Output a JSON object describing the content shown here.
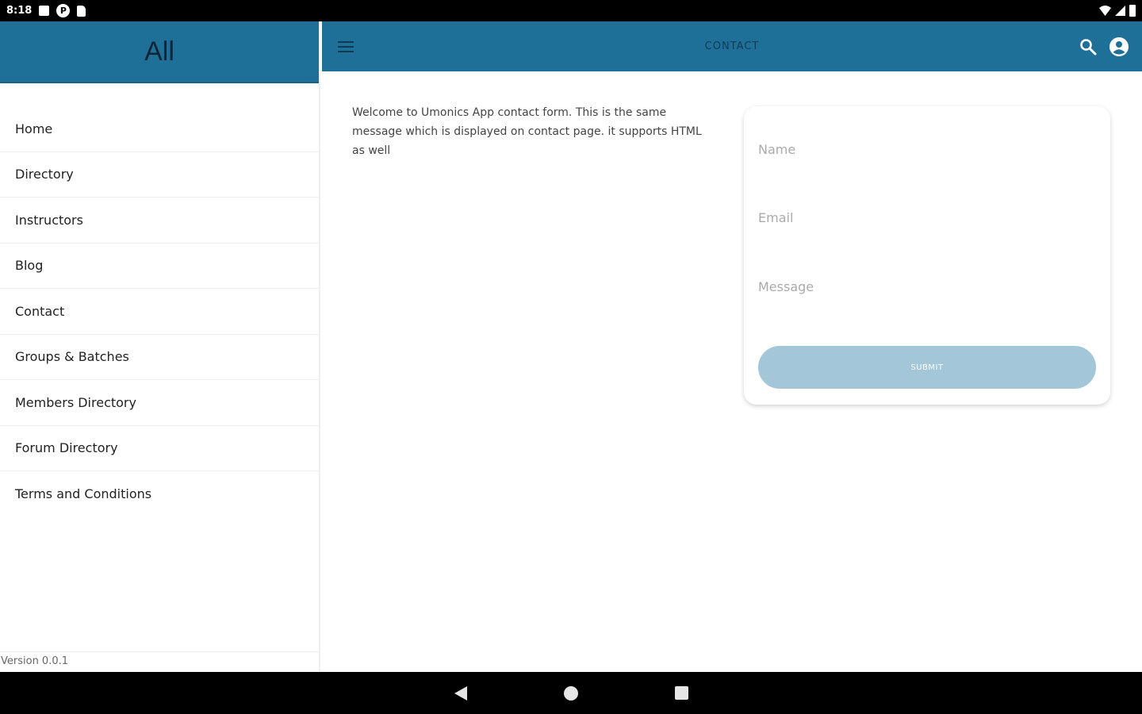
{
  "status_bar": {
    "time": "8:18",
    "app_badge": "P"
  },
  "sidebar": {
    "title": "All",
    "items": [
      {
        "label": "Home"
      },
      {
        "label": "Directory"
      },
      {
        "label": "Instructors"
      },
      {
        "label": "Blog"
      },
      {
        "label": "Contact"
      },
      {
        "label": "Groups & Batches"
      },
      {
        "label": "Members Directory"
      },
      {
        "label": "Forum Directory"
      },
      {
        "label": "Terms and Conditions"
      }
    ],
    "version": "Version 0.0.1"
  },
  "appbar": {
    "title": "CONTACT",
    "icons": [
      "menu-icon",
      "search-icon",
      "account-icon"
    ]
  },
  "content": {
    "welcome": "Welcome to Umonics App contact form. This is the same message which is displayed on contact page. it supports HTML as well"
  },
  "form": {
    "name_placeholder": "Name",
    "email_placeholder": "Email",
    "message_placeholder": "Message",
    "submit_label": "SUBMIT",
    "submit_color": "#a3c7d8"
  },
  "colors": {
    "primary": "#1f7098",
    "title_text": "#0e2336"
  }
}
